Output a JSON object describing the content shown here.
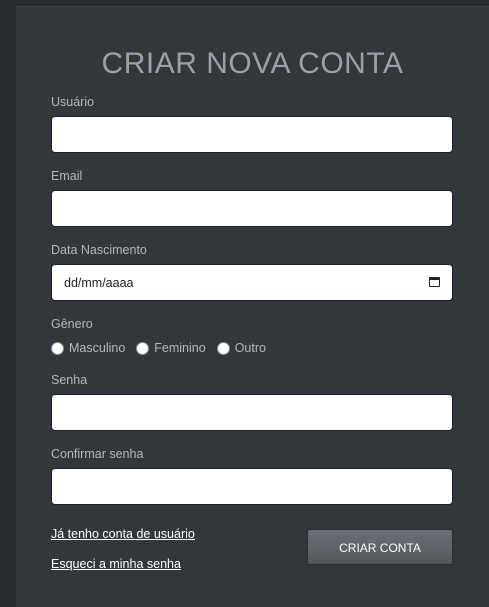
{
  "form": {
    "title": "CRIAR NOVA CONTA",
    "username": {
      "label": "Usuário",
      "value": ""
    },
    "email": {
      "label": "Email",
      "value": ""
    },
    "birthdate": {
      "label": "Data Nascimento",
      "placeholder": "dd/mm/aaaa"
    },
    "gender": {
      "label": "Gênero",
      "options": [
        "Masculino",
        "Feminino",
        "Outro"
      ]
    },
    "password": {
      "label": "Senha",
      "value": ""
    },
    "confirm_password": {
      "label": "Confirmar senha",
      "value": ""
    },
    "links": {
      "have_account": "Já tenho conta de usuário",
      "forgot_password": "Esqueci a minha senha"
    },
    "submit_label": "CRIAR CONTA"
  }
}
